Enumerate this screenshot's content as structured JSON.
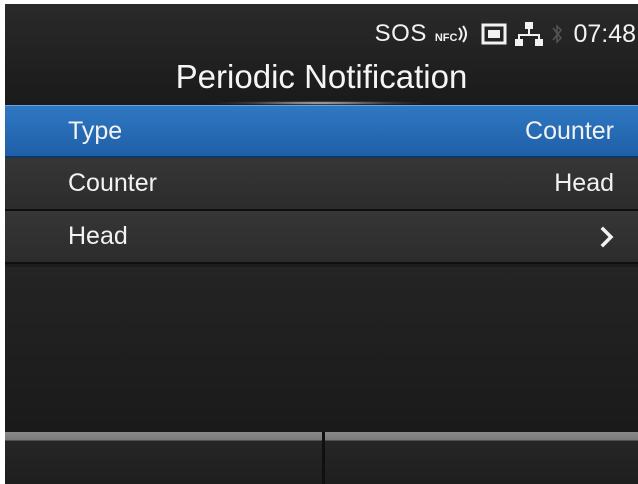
{
  "status_bar": {
    "sos": "SOS",
    "nfc": "NFC",
    "time": "07:48",
    "icons": [
      "nfc-icon",
      "sd-card-icon",
      "network-icon",
      "bluetooth-icon"
    ]
  },
  "header": {
    "title": "Periodic Notification"
  },
  "menu": {
    "items": [
      {
        "label": "Type",
        "value": "Counter",
        "selected": true
      },
      {
        "label": "Counter",
        "value": "Head",
        "selected": false
      },
      {
        "label": "Head",
        "value": "",
        "selected": false,
        "icon": "chevron-right-icon"
      }
    ]
  },
  "footer": {
    "left_softkey": "",
    "right_softkey": ""
  },
  "colors": {
    "selected_row": "#2a6fb8",
    "row": "#333333",
    "background": "#1c1c1c",
    "text": "#f2f2f2"
  }
}
